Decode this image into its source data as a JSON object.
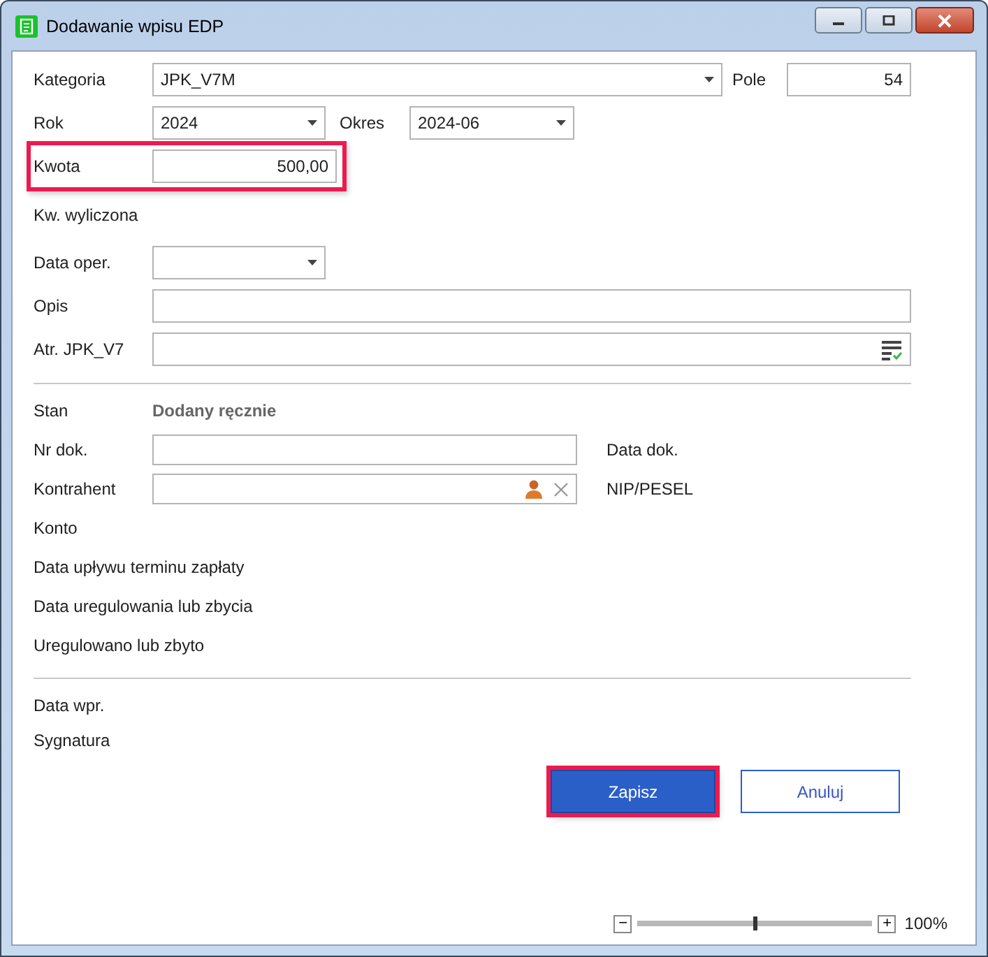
{
  "window": {
    "title": "Dodawanie wpisu EDP"
  },
  "kategoria": {
    "label": "Kategoria",
    "value": "JPK_V7M"
  },
  "pole": {
    "label": "Pole",
    "value": "54"
  },
  "rok": {
    "label": "Rok",
    "value": "2024"
  },
  "okres": {
    "label": "Okres",
    "value": "2024-06"
  },
  "kwota": {
    "label": "Kwota",
    "value": "500,00",
    "highlighted": true
  },
  "kw_wyliczona": {
    "label": "Kw. wyliczona"
  },
  "data_oper": {
    "label": "Data oper."
  },
  "opis": {
    "label": "Opis"
  },
  "atr": {
    "label": "Atr. JPK_V7"
  },
  "stan": {
    "label": "Stan",
    "value": "Dodany ręcznie"
  },
  "nr_dok": {
    "label": "Nr dok."
  },
  "data_dok": {
    "label": "Data dok."
  },
  "kontrahent": {
    "label": "Kontrahent"
  },
  "nip": {
    "label": "NIP/PESEL"
  },
  "info_labels": [
    "Konto",
    "Data upływu terminu zapłaty",
    "Data uregulowania lub zbycia",
    "Uregulowano lub zbyto"
  ],
  "footer_labels": [
    "Data wpr.",
    "Sygnatura"
  ],
  "buttons": [
    {
      "label": "Zapisz",
      "kind": "primary",
      "highlighted": true
    },
    {
      "label": "Anuluj",
      "kind": "secondary",
      "highlighted": false
    }
  ],
  "zoom": {
    "level": 0.5,
    "minus": "−",
    "plus": "+",
    "reading": "100%"
  }
}
